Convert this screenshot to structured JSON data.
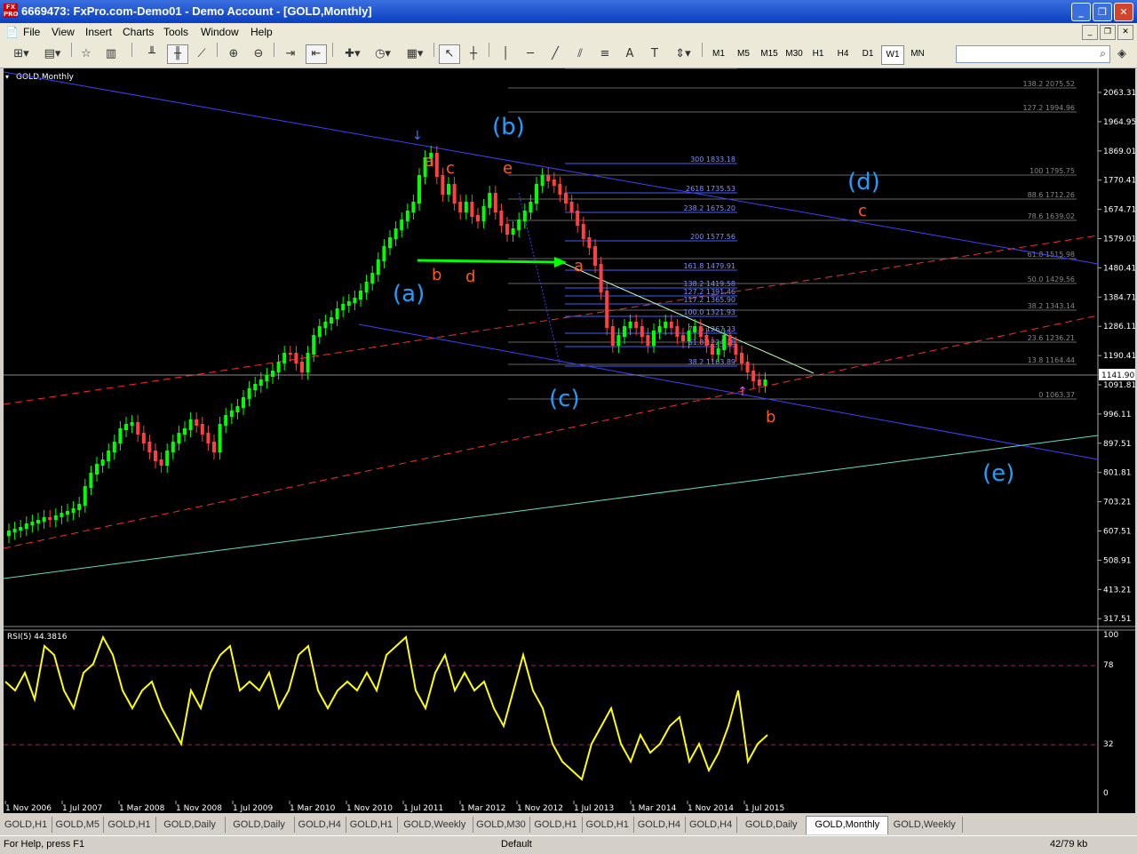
{
  "window": {
    "title": "6669473: FxPro.com-Demo01 - Demo Account - [GOLD,Monthly]",
    "app_icon_text": "FX PRO",
    "controls": [
      "minimize-icon",
      "maximize-icon",
      "close-icon"
    ]
  },
  "menu": [
    "File",
    "View",
    "Insert",
    "Charts",
    "Tools",
    "Window",
    "Help"
  ],
  "toolbar": {
    "timeframes": [
      "M1",
      "M5",
      "M15",
      "M30",
      "H1",
      "H4",
      "D1",
      "W1",
      "MN"
    ],
    "active_timeframe": "W1",
    "icons": [
      "new-chart-icon",
      "profiles-icon",
      "market-watch-icon",
      "navigator-icon",
      "bar-chart-icon",
      "candlestick-icon",
      "line-chart-icon",
      "zoom-in-icon",
      "zoom-out-icon",
      "autoscroll-icon",
      "chart-shift-icon",
      "indicators-icon",
      "periods-icon",
      "templates-icon",
      "cursor-icon",
      "crosshair-icon",
      "vertical-line-icon",
      "horizontal-line-icon",
      "trendline-icon",
      "fibonacci-icon",
      "channel-icon",
      "text-icon",
      "label-icon",
      "arrows-icon"
    ],
    "search_value": ""
  },
  "chart": {
    "symbol_label": "GOLD,Monthly",
    "price_axis": [
      "2063.31",
      "1964.95",
      "1869.01",
      "1770.41",
      "1674.71",
      "1579.01",
      "1480.41",
      "1384.71",
      "1286.11",
      "1190.41",
      "1091.81",
      "996.11",
      "897.51",
      "801.81",
      "703.21",
      "607.51",
      "508.91",
      "413.21",
      "317.51"
    ],
    "current_price": "1141.90",
    "rsi_label": "RSI(5) 44.3816",
    "rsi_axis": [
      "100",
      "78",
      "32",
      "0"
    ],
    "time_axis": [
      "1 Nov 2006",
      "1 Jul 2007",
      "1 Mar 2008",
      "1 Nov 2008",
      "1 Jul 2009",
      "1 Mar 2010",
      "1 Nov 2010",
      "1 Jul 2011",
      "1 Mar 2012",
      "1 Nov 2012",
      "1 Jul 2013",
      "1 Mar 2014",
      "1 Nov 2014",
      "1 Jul 2015"
    ],
    "fib_levels_right": [
      "138.2 2075.52",
      "127.2 1994.96",
      "100 1795.75",
      "88.6 1712.26",
      "78.6 1639.02",
      "61.8 1515.98",
      "50.0 1429.56",
      "38.2 1343.14",
      "23.6 1236.21",
      "13.8 1164.44",
      "0 1063.37"
    ],
    "fib_ext_levels": [
      "300 1833.18",
      "2618 1735.53",
      "238.2 1675.20",
      "200 1577.56",
      "161.8 1479.91",
      "138.2 1419.58",
      "127.2 1391.46",
      "117.2 1365.90",
      "100.0 1321.93",
      "78.6 1267.23",
      "61.8 1224.28",
      "38.2 1163.89"
    ],
    "wave_labels_blue": [
      "(a)",
      "(b)",
      "(c)",
      "(d)",
      "(e)"
    ],
    "wave_labels_orange": [
      "a",
      "b",
      "c",
      "d",
      "e",
      "a",
      "b",
      "c"
    ],
    "colors": {
      "bull": "#00ff00",
      "bear": "#ff4040",
      "wave_blue": "#1e9fff",
      "wave_orange": "#ff5a14",
      "rsi": "#ffff00"
    }
  },
  "tabs": [
    "GOLD,H1",
    "GOLD,M5",
    "GOLD,H1",
    "GOLD,Daily",
    "GOLD,Daily",
    "GOLD,H4",
    "GOLD,H1",
    "GOLD,Weekly",
    "GOLD,M30",
    "GOLD,H1",
    "GOLD,H1",
    "GOLD,H4",
    "GOLD,H4",
    "GOLD,Daily",
    "GOLD,Monthly",
    "GOLD,Weekly"
  ],
  "active_tab_index": 14,
  "status": {
    "help": "For Help, press F1",
    "profile": "Default",
    "traffic": "42/79 kb"
  }
}
